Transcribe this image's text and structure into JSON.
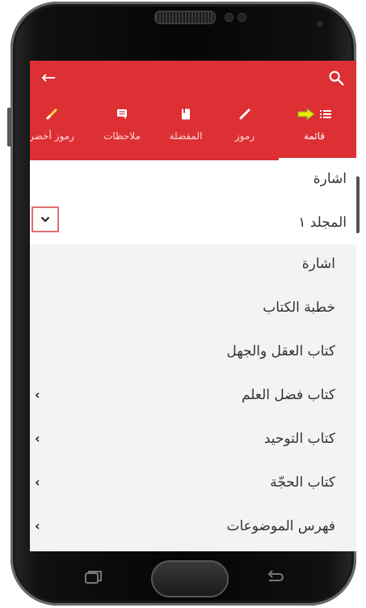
{
  "appbar": {
    "back_icon": "arrow-left-icon",
    "search_icon": "search-icon",
    "color": "#dc3034"
  },
  "tabs": [
    {
      "label": "رموز أخضر",
      "icon": "pencil-icon"
    },
    {
      "label": "ملاحظات",
      "icon": "comment-icon"
    },
    {
      "label": "المفضلة",
      "icon": "bookmark-icon"
    },
    {
      "label": "رموز",
      "icon": "pencil-icon"
    },
    {
      "label": "قائمة",
      "icon": "list-icon"
    }
  ],
  "list": {
    "top_label": "اشارة",
    "volume_label": "المجلد ١",
    "items": [
      {
        "label": "اشارة",
        "has_chevron": false
      },
      {
        "label": "خطبة الكتاب",
        "has_chevron": false
      },
      {
        "label": "كتاب العقل والجهل",
        "has_chevron": false
      },
      {
        "label": "كتاب فضل العلم",
        "has_chevron": true
      },
      {
        "label": "كتاب التوحيد",
        "has_chevron": true
      },
      {
        "label": "كتاب الحجّة",
        "has_chevron": true
      },
      {
        "label": "فهرس الموضوعات",
        "has_chevron": true
      }
    ]
  }
}
